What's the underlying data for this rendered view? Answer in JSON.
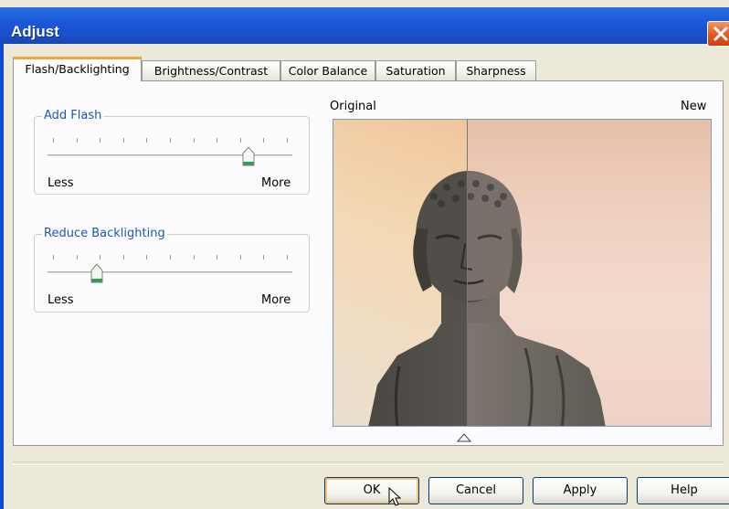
{
  "window": {
    "title": "Adjust"
  },
  "tabs": [
    {
      "label": "Flash/Backlighting",
      "active": true
    },
    {
      "label": "Brightness/Contrast",
      "active": false
    },
    {
      "label": "Color Balance",
      "active": false
    },
    {
      "label": "Saturation",
      "active": false
    },
    {
      "label": "Sharpness",
      "active": false
    }
  ],
  "sliders": {
    "add_flash": {
      "label": "Add Flash",
      "min_label": "Less",
      "max_label": "More",
      "value_fraction": 0.82
    },
    "reduce_backlighting": {
      "label": "Reduce Backlighting",
      "min_label": "Less",
      "max_label": "More",
      "value_fraction": 0.2
    }
  },
  "preview": {
    "original_label": "Original",
    "new_label": "New"
  },
  "buttons": {
    "ok": "OK",
    "cancel": "Cancel",
    "apply": "Apply",
    "help": "Help"
  },
  "colors": {
    "title_bar": "#1b58d8",
    "active_tab_accent": "#f0a838",
    "group_label": "#2154b9",
    "close_button": "#e2581f"
  },
  "icons": {
    "close": "close-x-icon",
    "cursor": "mouse-pointer-icon",
    "split_marker": "triangle-marker-icon"
  }
}
